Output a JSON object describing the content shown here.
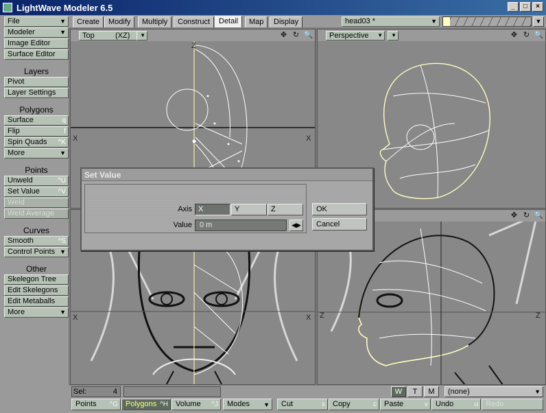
{
  "window": {
    "title": "LightWave Modeler 6.5",
    "controls": [
      "_",
      "□",
      "×"
    ]
  },
  "tabs": [
    "Create",
    "Modify",
    "Multiply",
    "Construct",
    "Detail",
    "Map",
    "Display"
  ],
  "active_tab": "Detail",
  "object_selector": "head03 *",
  "left_panel": {
    "file": "File",
    "modeler": "Modeler",
    "image_editor": "Image Editor",
    "surface_editor": "Surface Editor",
    "layers_header": "Layers",
    "pivot": "Pivot",
    "layer_settings": "Layer Settings",
    "polygons_header": "Polygons",
    "surface": "Surface",
    "surface_key": "q",
    "flip": "Flip",
    "flip_key": "f",
    "spin_quads": "Spin Quads",
    "spin_quads_key": "^K",
    "more1": "More",
    "points_header": "Points",
    "unweld": "Unweld",
    "unweld_key": "^U",
    "set_value": "Set Value",
    "set_value_key": "^V",
    "weld": "Weld",
    "weld_average": "Weld Average",
    "curves_header": "Curves",
    "smooth": "Smooth",
    "smooth_key": "^S",
    "control_points": "Control Points",
    "other_header": "Other",
    "skelegon_tree": "Skelegon Tree",
    "edit_skelegons": "Edit Skelegons",
    "edit_metaballs": "Edit Metaballs",
    "more2": "More"
  },
  "viewports": {
    "top_left": {
      "mode": "Top",
      "axes": "(XZ)",
      "label_top": "Z",
      "label_left": "X",
      "label_right": "X"
    },
    "top_right": {
      "mode": "Perspective"
    },
    "bottom_left": {
      "label_left": "X",
      "label_right": "X"
    },
    "bottom_right": {
      "label_left": "Z",
      "label_right": "Z"
    }
  },
  "dialog": {
    "title": "Set Value",
    "axis_label": "Axis",
    "axis_options": [
      "X",
      "Y",
      "Z"
    ],
    "axis_selected": "X",
    "value_label": "Value",
    "value": "0 m",
    "ok": "OK",
    "cancel": "Cancel"
  },
  "status": {
    "sel_label": "Sel:",
    "sel_count": "4",
    "wtm": [
      "W",
      "T",
      "M"
    ],
    "wtm_active": "W",
    "surface_select": "(none)"
  },
  "bottom_bar": {
    "points": "Points",
    "points_key": "^G",
    "polygons": "Polygons",
    "polygons_key": "^H",
    "volume": "Volume",
    "volume_key": "^J",
    "modes": "Modes",
    "cut": "Cut",
    "cut_key": "x",
    "copy": "Copy",
    "copy_key": "c",
    "paste": "Paste",
    "paste_key": "v",
    "undo": "Undo",
    "undo_key": "u",
    "redo": "Redo"
  },
  "colors": {
    "mesh": "#ffffff",
    "selected_mesh": "#ffffb0",
    "viewport_bg": "#888888",
    "active_tab": "#f0f0f0"
  }
}
